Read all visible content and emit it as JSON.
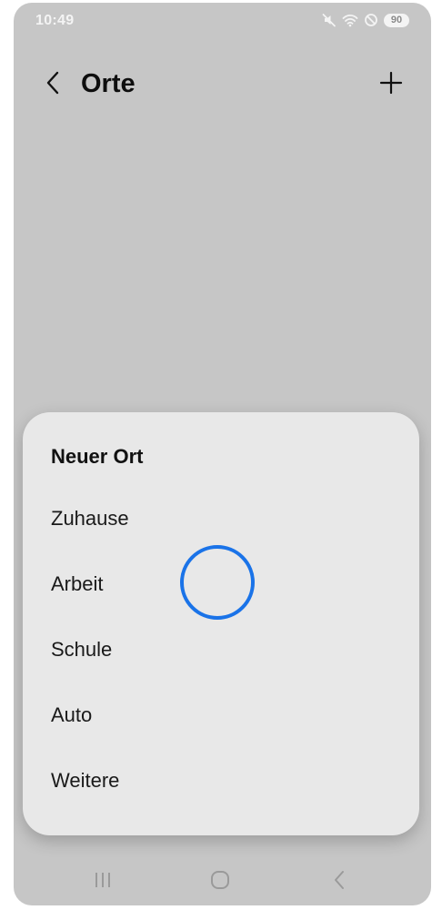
{
  "status_bar": {
    "time": "10:49",
    "battery": "90",
    "icons": [
      "mute-icon",
      "wifi-icon",
      "do-not-disturb-icon"
    ]
  },
  "header": {
    "title": "Orte",
    "back_icon": "chevron-left-icon",
    "add_icon": "plus-icon"
  },
  "popup": {
    "title": "Neuer Ort",
    "items": [
      {
        "label": "Zuhause"
      },
      {
        "label": "Arbeit"
      },
      {
        "label": "Schule"
      },
      {
        "label": "Auto"
      },
      {
        "label": "Weitere"
      }
    ]
  },
  "nav_bar": {
    "icons": [
      "recent-apps-icon",
      "home-icon",
      "back-icon"
    ]
  },
  "colors": {
    "background_dim": "#c6c6c6",
    "popup_background": "#e8e8e8",
    "touch_indicator": "#1a73e8"
  }
}
